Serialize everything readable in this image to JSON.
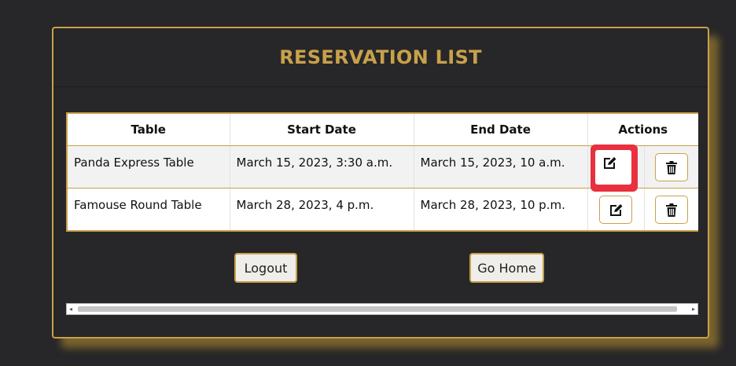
{
  "card": {
    "title": "RESERVATION LIST"
  },
  "table": {
    "headers": [
      "Table",
      "Start Date",
      "End Date",
      "Actions"
    ],
    "rows": [
      {
        "table": "Panda Express Table",
        "start": "March 15, 2023, 3:30 a.m.",
        "end": "March 15, 2023, 10 a.m."
      },
      {
        "table": "Famouse Round Table",
        "start": "March 28, 2023, 4 p.m.",
        "end": "March 28, 2023, 10 p.m."
      }
    ]
  },
  "buttons": {
    "logout": "Logout",
    "go_home": "Go Home"
  },
  "scrollbar": {
    "left_arrow": "◂",
    "right_arrow": "▸"
  },
  "icons": {
    "edit": "edit-icon",
    "delete": "trash-icon"
  },
  "colors": {
    "background": "#272729",
    "accent": "#c9a14a",
    "highlight": "#e8303e"
  }
}
